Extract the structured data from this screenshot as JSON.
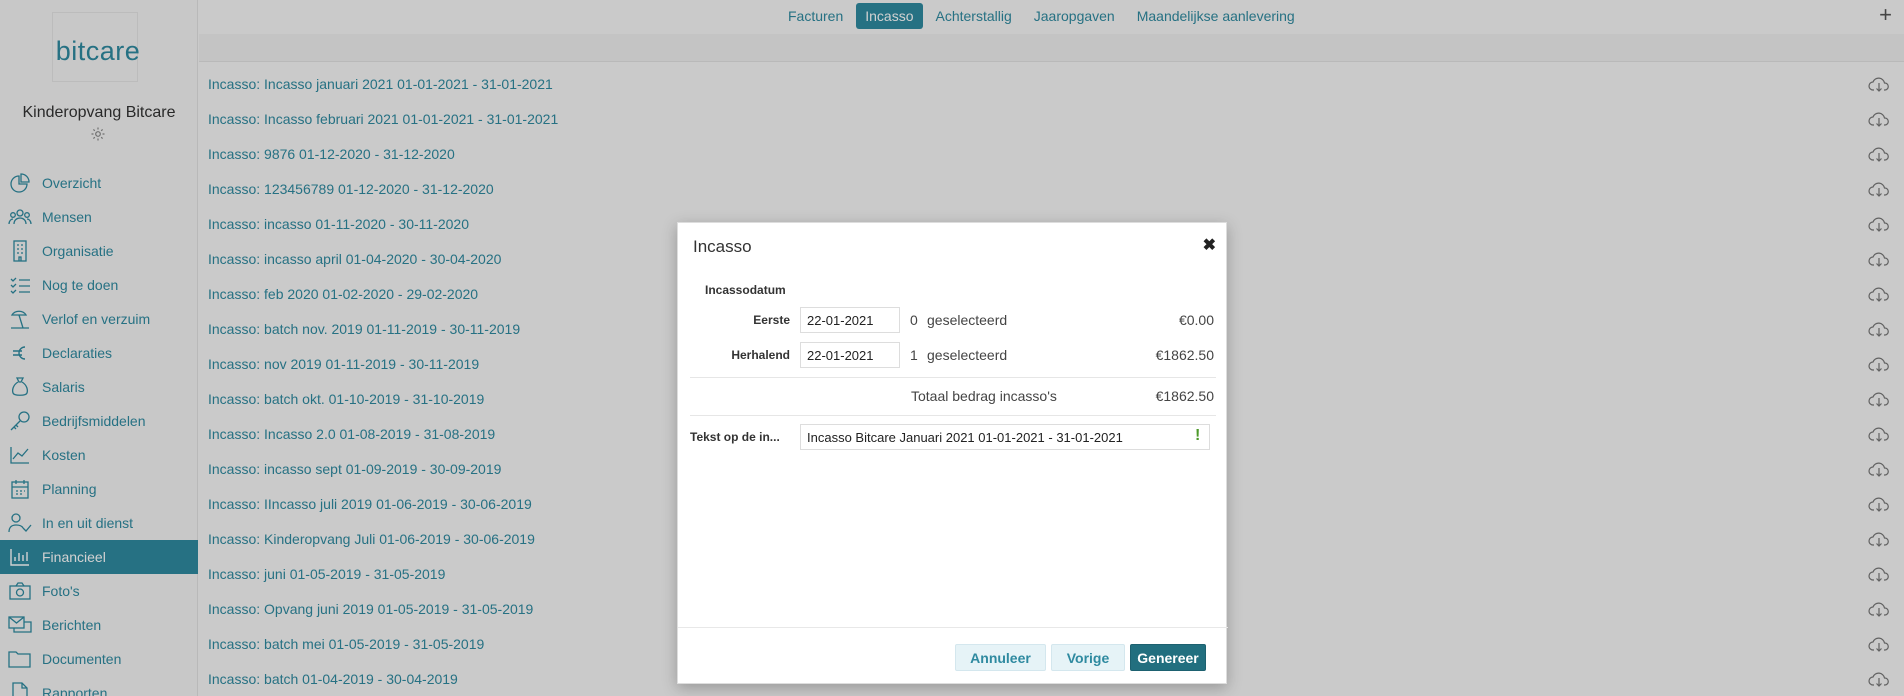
{
  "sidebar": {
    "logo": "bitcare",
    "org_name": "Kinderopvang Bitcare",
    "items": [
      {
        "label": "Overzicht",
        "icon": "pie-chart-icon"
      },
      {
        "label": "Mensen",
        "icon": "people-icon"
      },
      {
        "label": "Organisatie",
        "icon": "building-icon"
      },
      {
        "label": "Nog te doen",
        "icon": "checklist-icon"
      },
      {
        "label": "Verlof en verzuim",
        "icon": "beach-icon"
      },
      {
        "label": "Declaraties",
        "icon": "euro-icon"
      },
      {
        "label": "Salaris",
        "icon": "money-bag-icon"
      },
      {
        "label": "Bedrijfsmiddelen",
        "icon": "key-icon"
      },
      {
        "label": "Kosten",
        "icon": "line-chart-icon"
      },
      {
        "label": "Planning",
        "icon": "calendar-icon"
      },
      {
        "label": "In en uit dienst",
        "icon": "user-check-icon"
      },
      {
        "label": "Financieel",
        "icon": "bar-chart-icon",
        "active": true
      },
      {
        "label": "Foto's",
        "icon": "camera-icon"
      },
      {
        "label": "Berichten",
        "icon": "messages-icon"
      },
      {
        "label": "Documenten",
        "icon": "folder-icon"
      },
      {
        "label": "Rapporten",
        "icon": "document-icon"
      }
    ]
  },
  "tabs": [
    {
      "label": "Facturen"
    },
    {
      "label": "Incasso",
      "active": true
    },
    {
      "label": "Achterstallig"
    },
    {
      "label": "Jaaropgaven"
    },
    {
      "label": "Maandelijkse aanlevering"
    }
  ],
  "list": [
    "Incasso: Incasso januari 2021 01-01-2021 - 31-01-2021",
    "Incasso: Incasso februari 2021 01-01-2021 - 31-01-2021",
    "Incasso: 9876 01-12-2020 - 31-12-2020",
    "Incasso: 123456789 01-12-2020 - 31-12-2020",
    "Incasso: incasso 01-11-2020 - 30-11-2020",
    "Incasso: incasso april 01-04-2020 - 30-04-2020",
    "Incasso: feb 2020 01-02-2020 - 29-02-2020",
    "Incasso: batch nov. 2019 01-11-2019 - 30-11-2019",
    "Incasso: nov 2019 01-11-2019 - 30-11-2019",
    "Incasso: batch okt. 01-10-2019 - 31-10-2019",
    "Incasso: Incasso 2.0 01-08-2019 - 31-08-2019",
    "Incasso: incasso sept 01-09-2019 - 30-09-2019",
    "Incasso: IIncasso juli 2019 01-06-2019 - 30-06-2019",
    "Incasso: Kinderopvang Juli 01-06-2019 - 30-06-2019",
    "Incasso: juni 01-05-2019 - 31-05-2019",
    "Incasso: Opvang juni 2019 01-05-2019 - 31-05-2019",
    "Incasso: batch mei 01-05-2019 - 31-05-2019",
    "Incasso: batch 01-04-2019 - 30-04-2019"
  ],
  "modal": {
    "title": "Incasso",
    "section": "Incassodatum",
    "first": {
      "label": "Eerste",
      "date": "22-01-2021",
      "count": "0",
      "selected": "geselecteerd",
      "amount": "€0.00"
    },
    "recurring": {
      "label": "Herhalend",
      "date": "22-01-2021",
      "count": "1",
      "selected": "geselecteerd",
      "amount": "€1862.50"
    },
    "total_label": "Totaal bedrag incasso's",
    "total_amount": "€1862.50",
    "text_label": "Tekst op de in...",
    "text_value": "Incasso Bitcare Januari 2021 01-01-2021 - 31-01-2021",
    "warn": "!",
    "buttons": {
      "cancel": "Annuleer",
      "prev": "Vorige",
      "generate": "Genereer"
    }
  },
  "colors": {
    "accent": "#2f8aa0",
    "accent_dark": "#226f7f",
    "warn": "#4d9a2a"
  }
}
